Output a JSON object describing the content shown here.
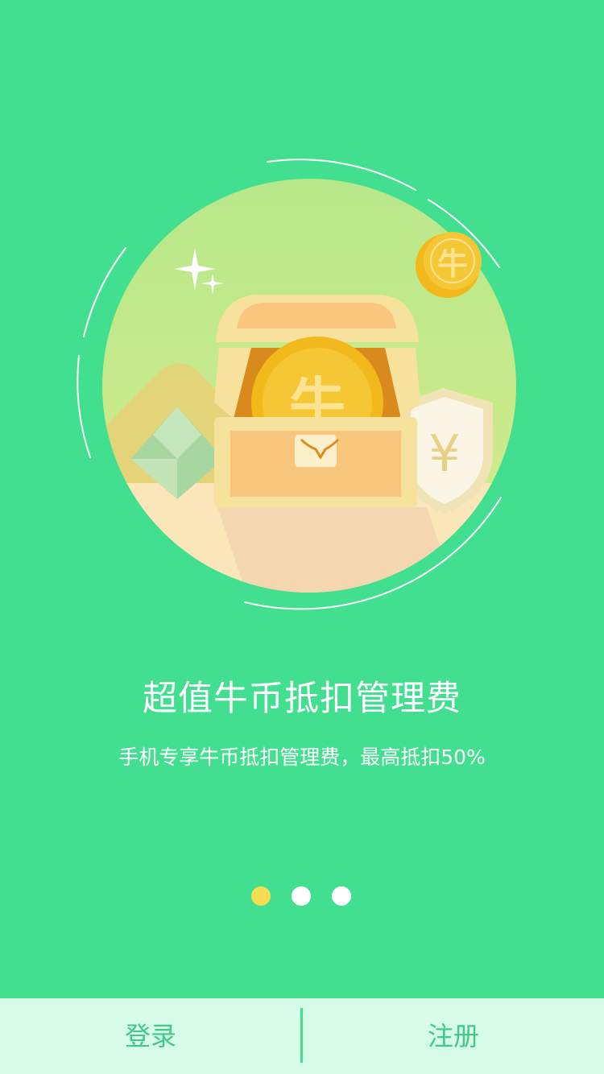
{
  "slide": {
    "title": "超值牛币抵扣管理费",
    "subtitle": "手机专享牛币抵扣管理费，最高抵扣50%",
    "coin_char": "牛",
    "shield_char": "¥",
    "illustration_icons": [
      "treasure-chest-icon",
      "gold-coin-icon",
      "shield-yuan-icon",
      "diamond-icon",
      "sparkle-icon"
    ]
  },
  "pager": {
    "count": 3,
    "active_index": 0
  },
  "bottom_bar": {
    "login_label": "登录",
    "register_label": "注册"
  },
  "colors": {
    "background": "#42df91",
    "bottom_bar": "#d6fbe7",
    "button_text": "#42c88a",
    "active_dot": "#f7dd53",
    "inactive_dot": "#ffffff"
  }
}
